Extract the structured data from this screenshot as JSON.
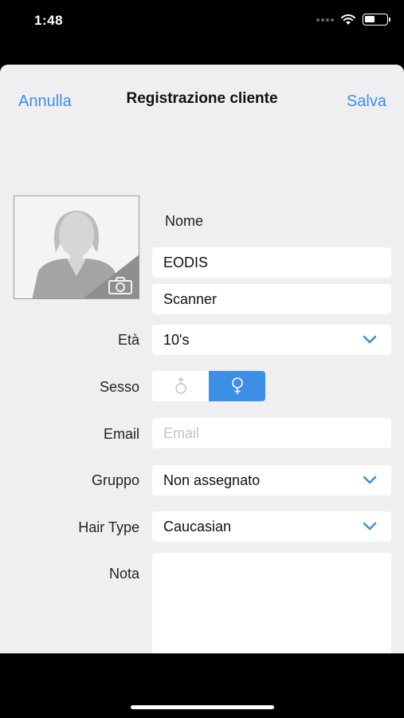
{
  "status_bar": {
    "time": "1:48"
  },
  "nav": {
    "cancel": "Annulla",
    "title": "Registrazione cliente",
    "save": "Salva"
  },
  "form": {
    "name_label": "Nome",
    "first_name": "EODIS",
    "last_name": "Scanner",
    "age_label": "Età",
    "age_value": "10's",
    "sex_label": "Sesso",
    "sex_selected": "female",
    "email_label": "Email",
    "email_placeholder": "Email",
    "group_label": "Gruppo",
    "group_value": "Non assegnato",
    "hair_label": "Hair Type",
    "hair_value": "Caucasian",
    "note_label": "Nota"
  },
  "colors": {
    "accent": "#3b8fe4",
    "background": "#efeff1"
  },
  "icons": [
    "wifi-icon",
    "battery-icon",
    "avatar-placeholder-icon",
    "camera-icon",
    "chevron-down-icon",
    "male-icon",
    "female-icon"
  ]
}
